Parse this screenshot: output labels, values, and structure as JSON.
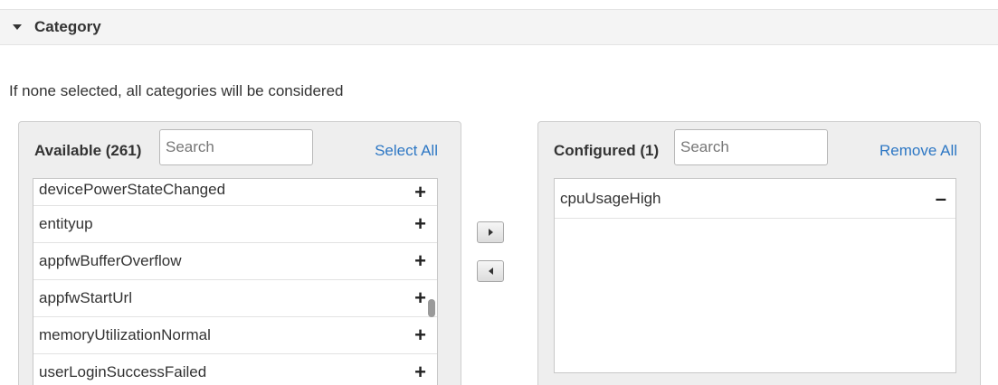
{
  "section": {
    "title": "Category",
    "icon": "caret-down-icon"
  },
  "hint": "If none selected, all categories will be considered",
  "available": {
    "title": "Available (261)",
    "search_placeholder": "Search",
    "select_all": "Select All",
    "items": [
      {
        "label": "devicePowerStateChanged",
        "action": "+"
      },
      {
        "label": "entityup",
        "action": "+"
      },
      {
        "label": "appfwBufferOverflow",
        "action": "+"
      },
      {
        "label": "appfwStartUrl",
        "action": "+"
      },
      {
        "label": "memoryUtilizationNormal",
        "action": "+"
      },
      {
        "label": "userLoginSuccessFailed",
        "action": "+"
      }
    ]
  },
  "configured": {
    "title": "Configured (1)",
    "search_placeholder": "Search",
    "remove_all": "Remove All",
    "items": [
      {
        "label": "cpuUsageHigh",
        "action": "–"
      }
    ]
  },
  "icons": {
    "move_right": "arrow-right-icon",
    "move_left": "arrow-left-icon"
  },
  "colors": {
    "link": "#2d77c4",
    "header_bg": "#f4f4f4",
    "panel_bg": "#eeeeee"
  }
}
